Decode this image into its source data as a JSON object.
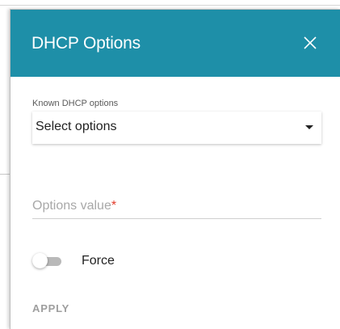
{
  "dialog": {
    "title": "DHCP Options",
    "header_color": "#1e8fa8",
    "close_icon": "close-icon"
  },
  "known_options": {
    "label": "Known DHCP options",
    "selected": "Select options",
    "caret_icon": "caret-down-icon"
  },
  "options_value": {
    "label": "Options value",
    "required_mark": "*",
    "required_color": "#e23a2a",
    "value": ""
  },
  "force": {
    "label": "Force",
    "enabled": false
  },
  "actions": {
    "apply_label": "APPLY"
  }
}
